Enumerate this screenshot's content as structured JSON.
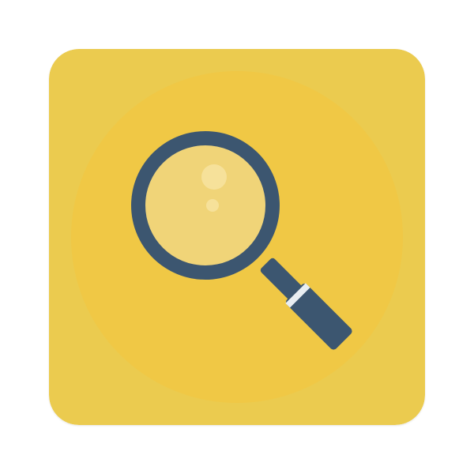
{
  "app_icon": {
    "icon": "magnifying-glass-icon",
    "colors": {
      "tile_background": "#EBCB4F",
      "inner_circle": "#F0C845",
      "lens_fill": "#F0D478",
      "lens_highlight": "#F8E6A6",
      "frame": "#3C5670",
      "ferrule_stripe": "#E9EEF2"
    }
  }
}
